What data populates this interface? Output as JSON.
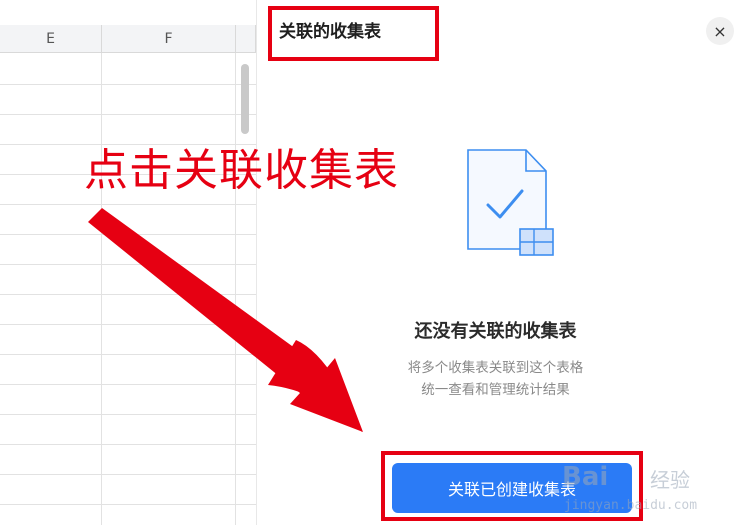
{
  "sheet": {
    "columns": [
      "E",
      "F"
    ]
  },
  "panel": {
    "title": "关联的收集表",
    "close_icon": "×",
    "empty_title": "还没有关联的收集表",
    "empty_desc_line1": "将多个收集表关联到这个表格",
    "empty_desc_line2": "统一查看和管理统计结果",
    "primary_button": "关联已创建收集表"
  },
  "annotation": {
    "callout_text": "点击关联收集表",
    "color": "#e60012"
  },
  "watermark": {
    "logo": "Bai",
    "text": "经验",
    "url": "jingyan.baidu.com"
  },
  "colors": {
    "accent": "#2b7bf6",
    "illustration": "#3d8ef0"
  }
}
